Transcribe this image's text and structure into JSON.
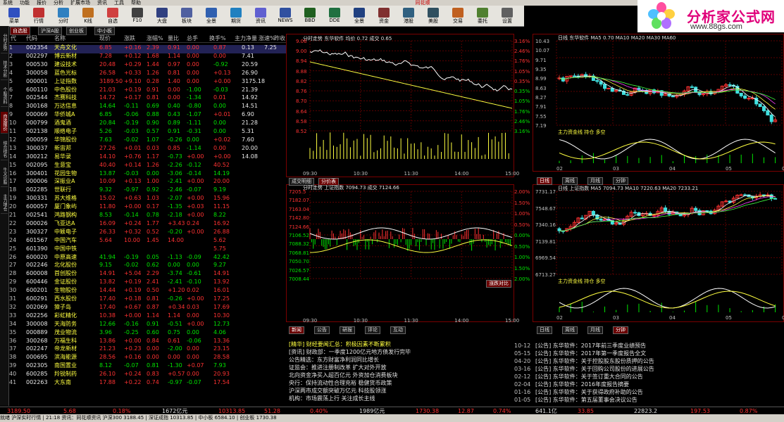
{
  "menu": [
    "系统",
    "功能",
    "报价",
    "分析",
    "扩展市场",
    "资讯",
    "工具",
    "帮助"
  ],
  "brand_center": "同花顺",
  "toolbar": [
    {
      "label": "菜单",
      "color": "#3050c0"
    },
    {
      "label": "行情",
      "color": "#c03030"
    },
    {
      "label": "分时",
      "color": "#3080c0"
    },
    {
      "label": "K线",
      "color": "#c07020"
    },
    {
      "label": "自选",
      "color": "#d04040"
    },
    {
      "label": "F10",
      "color": "#404040"
    },
    {
      "label": "大盘",
      "color": "#304080"
    },
    {
      "label": "板块",
      "color": "#5060a0"
    },
    {
      "label": "全景",
      "color": "#3060b0"
    },
    {
      "label": "期货",
      "color": "#2080c0"
    },
    {
      "label": "资讯",
      "color": "#6060d0"
    },
    {
      "label": "NEWS",
      "color": "#3050a0"
    },
    {
      "label": "BBD",
      "color": "#206020"
    },
    {
      "label": "DDE",
      "color": "#207040"
    },
    {
      "label": "全景",
      "color": "#204080"
    },
    {
      "label": "资金",
      "color": "#803030"
    },
    {
      "label": "港股",
      "color": "#306080"
    },
    {
      "label": "美股",
      "color": "#305060"
    },
    {
      "label": "交易",
      "color": "#c06020"
    },
    {
      "label": "委托",
      "color": "#508030"
    },
    {
      "label": "设置",
      "color": "#606060"
    }
  ],
  "ad": {
    "title": "分析家公式网",
    "url": "www.88gs.com"
  },
  "vertical_tabs": [
    "分时走势",
    "技术分析",
    "个股资料",
    "自选报价",
    "综合排名",
    "牛叉诊股",
    "主力增仓"
  ],
  "sheet_tabs": [
    "自选股",
    "沪深A股",
    "创业板",
    "中小板"
  ],
  "table": {
    "headers": [
      "代",
      "代码",
      "名称",
      "现价",
      "涨跌",
      "涨幅%",
      "量比",
      "总手",
      "换手%",
      "主力净量",
      "涨速%",
      "昨收"
    ],
    "rows": [
      [
        "1",
        "002354",
        "天舟文化",
        "6.85",
        "+0.16",
        "2.39",
        "0.91",
        "0.00",
        "0.87",
        "0.13",
        "7.25"
      ],
      [
        "2",
        "002297",
        "博云新材",
        "7.28",
        "+0.12",
        "1.68",
        "1.14",
        "0.00",
        "0.00",
        "7.41",
        ""
      ],
      [
        "3",
        "000530",
        "建设技术",
        "20.48",
        "+0.29",
        "1.44",
        "0.97",
        "0.00",
        "-0.92",
        "20.59",
        ""
      ],
      [
        "4",
        "300058",
        "蓝色光标",
        "26.58",
        "+0.33",
        "1.26",
        "0.81",
        "0.00",
        "+0.13",
        "26.90",
        ""
      ],
      [
        "5",
        "000001",
        "上证指数",
        "3189.50",
        "+9.10",
        "0.28",
        "1.40",
        "0.00",
        "+0.00",
        "3175.18",
        ""
      ],
      [
        "6",
        "600110",
        "中色股份",
        "21.03",
        "+0.19",
        "0.91",
        "0.00",
        "-1.00",
        "-0.03",
        "21.39",
        ""
      ],
      [
        "7",
        "002544",
        "杰赛科技",
        "14.72",
        "+0.17",
        "0.81",
        "0.00",
        "-1.34",
        "0.01",
        "14.92",
        ""
      ],
      [
        "8",
        "300168",
        "万达信息",
        "14.64",
        "-0.11",
        "0.69",
        "0.40",
        "-0.80",
        "0.00",
        "14.51",
        ""
      ],
      [
        "9",
        "000069",
        "华侨城A",
        "6.85",
        "-0.06",
        "0.88",
        "0.43",
        "-1.07",
        "+0.01",
        "6.90",
        ""
      ],
      [
        "10",
        "000799",
        "酒鬼酒",
        "20.84",
        "-0.19",
        "0.90",
        "0.89",
        "-1.11",
        "0.00",
        "21.28",
        ""
      ],
      [
        "11",
        "002138",
        "顺络电子",
        "5.26",
        "-0.03",
        "0.57",
        "0.91",
        "-0.31",
        "0.00",
        "5.31",
        ""
      ],
      [
        "12",
        "000059",
        "华锦股份",
        "7.63",
        "-0.02",
        "1.07",
        "-0.26",
        "0.00",
        "+0.02",
        "7.60",
        ""
      ],
      [
        "13",
        "300037",
        "新宙邦",
        "27.26",
        "+0.01",
        "0.03",
        "0.85",
        "-1.14",
        "0.00",
        "20.00",
        ""
      ],
      [
        "14",
        "300212",
        "易华录",
        "14.10",
        "+0.76",
        "1.17",
        "-0.73",
        "+0.00",
        "+0.00",
        "14.08",
        ""
      ],
      [
        "15",
        "002095",
        "生意宝",
        "40.40",
        "+0.14",
        "1.26",
        "-2.26",
        "-0.12",
        "40.52",
        ""
      ],
      [
        "16",
        "300401",
        "花园生物",
        "13.87",
        "-0.03",
        "0.00",
        "-3.06",
        "-0.14",
        "14.19",
        ""
      ],
      [
        "17",
        "000006",
        "深振业A",
        "10.09",
        "+0.13",
        "1.00",
        "-2.41",
        "+0.00",
        "20.00",
        ""
      ],
      [
        "18",
        "002285",
        "世联行",
        "9.32",
        "-0.97",
        "0.92",
        "-2.46",
        "-0.07",
        "9.19",
        ""
      ],
      [
        "19",
        "300331",
        "苏大维格",
        "15.02",
        "+0.63",
        "1.03",
        "-2.07",
        "+0.00",
        "15.96",
        ""
      ],
      [
        "20",
        "600057",
        "厦门象屿",
        "11.80",
        "+0.00",
        "0.17",
        "-1.35",
        "+0.03",
        "11.15",
        ""
      ],
      [
        "21",
        "002541",
        "鸿路钢构",
        "8.53",
        "-0.14",
        "0.78",
        "-2.18",
        "+0.00",
        "8.22",
        ""
      ],
      [
        "22",
        "000026",
        "飞亚达A",
        "16.09",
        "+0.24",
        "1.77",
        "+3.43",
        "0.24",
        "16.92",
        ""
      ],
      [
        "23",
        "300327",
        "中颖电子",
        "26.33",
        "+0.32",
        "0.52",
        "-0.20",
        "+0.00",
        "26.88",
        ""
      ],
      [
        "24",
        "601567",
        "中国汽车",
        "5.64",
        "10.00",
        "1.45",
        "14.00",
        "",
        "5.62",
        ""
      ],
      [
        "25",
        "601390",
        "中国中铁",
        "",
        "",
        "",
        "",
        "",
        "5.75",
        ""
      ],
      [
        "26",
        "600020",
        "中原高速",
        "41.94",
        "-0.19",
        "0.05",
        "-1.13",
        "-0.09",
        "42.42",
        ""
      ],
      [
        "27",
        "002246",
        "北化股份",
        "9.15",
        "-0.02",
        "0.62",
        "0.00",
        "0.00",
        "9.27",
        ""
      ],
      [
        "28",
        "600008",
        "首创股份",
        "14.91",
        "+5.04",
        "2.29",
        "-3.74",
        "-0.61",
        "14.91",
        ""
      ],
      [
        "29",
        "600446",
        "金证股份",
        "13.82",
        "+0.19",
        "2.41",
        "-2.41",
        "-0.10",
        "13.92",
        ""
      ],
      [
        "30",
        "600201",
        "生物股份",
        "14.44",
        "+0.19",
        "0.50",
        "+1.20",
        "0.02",
        "16.01",
        ""
      ],
      [
        "31",
        "600291",
        "西水股份",
        "17.40",
        "+0.18",
        "0.81",
        "-0.26",
        "+0.00",
        "17.25",
        ""
      ],
      [
        "32",
        "002069",
        "獐子岛",
        "17.40",
        "+0.67",
        "0.87",
        "+0.34",
        "0.03",
        "17.69",
        ""
      ],
      [
        "33",
        "002256",
        "彩虹精化",
        "10.38",
        "+0.00",
        "1.14",
        "1.14",
        "0.00",
        "10.30",
        ""
      ],
      [
        "34",
        "300008",
        "天海防务",
        "12.66",
        "-0.16",
        "0.91",
        "-0.51",
        "+0.00",
        "12.73",
        ""
      ],
      [
        "35",
        "000889",
        "茂业物流",
        "3.96",
        "-0.25",
        "0.60",
        "0.75",
        "0.00",
        "4.06",
        ""
      ],
      [
        "36",
        "300268",
        "万福生科",
        "13.86",
        "+0.00",
        "0.84",
        "0.61",
        "-0.06",
        "13.36",
        ""
      ],
      [
        "37",
        "002247",
        "帝龙新材",
        "21.23",
        "+0.23",
        "0.00",
        "-2.00",
        "0.00",
        "23.15",
        ""
      ],
      [
        "38",
        "000695",
        "滨海能源",
        "28.56",
        "+0.16",
        "0.00",
        "0.00",
        "0.00",
        "28.58",
        ""
      ],
      [
        "39",
        "002305",
        "南国置业",
        "8.12",
        "-0.07",
        "0.81",
        "-1.30",
        "+0.07",
        "7.93",
        ""
      ],
      [
        "40",
        "600285",
        "羚锐制药",
        "26.10",
        "+0.24",
        "0.83",
        "+0.57",
        "0.00",
        "20.93",
        ""
      ],
      [
        "41",
        "002263",
        "大东南",
        "17.88",
        "+0.22",
        "0.74",
        "-0.97",
        "-0.07",
        "17.54",
        ""
      ]
    ]
  },
  "intraday_top": {
    "title": "分时走势 东华软件 均价 0.72 成交 0.65",
    "price_labels": [
      "9.06",
      "9.00",
      "8.94",
      "8.88",
      "8.82",
      "8.76",
      "8.70",
      "8.64",
      "8.58",
      "8.52"
    ],
    "pct_labels": [
      "3.16%",
      "2.46%",
      "1.76%",
      "1.05%",
      "0.35%",
      "0.35%",
      "1.05%",
      "1.76%",
      "2.46%",
      "3.16%"
    ],
    "time_labels": [
      "09:30",
      "10:30",
      "11:30",
      "14:00",
      "15:00"
    ],
    "tabs": [
      "成交明细",
      "分价表"
    ]
  },
  "intraday_bottom": {
    "title": "分时走势 上证指数 7094.73 成交 7124.66",
    "price_labels": [
      "7205.5",
      "7182.07",
      "7163.04",
      "7142.80",
      "7124.66",
      "7106.52",
      "7088.32",
      "7068.81",
      "7050.70",
      "7026.57",
      "7008.44"
    ],
    "pct_labels": [
      "2.00%",
      "1.50%",
      "1.00%",
      "0.50%",
      "0.00%",
      "0.50%",
      "1.00%",
      "1.50%",
      "2.00%"
    ],
    "time_labels": [
      "09:30",
      "10:30",
      "11:30",
      "14:00",
      "15:00"
    ],
    "tag": "涨跌对比"
  },
  "kline_top": {
    "title": "日线 东华软件 MA5 0.70 MA10 MA20 MA30 MA60",
    "price_labels": [
      "10.43",
      "10.07",
      "9.71",
      "9.35",
      "8.99",
      "8.63",
      "8.27",
      "7.91",
      "7.55",
      "7.19"
    ],
    "vol_label": "主力资金线 持仓 多空",
    "date_labels": [
      "02",
      "03",
      "04",
      "05",
      "06"
    ],
    "tabs": [
      "日线",
      "周线",
      "月线",
      "分钟"
    ]
  },
  "kline_bottom": {
    "title": "日线 上证指数 MA5 7094.73 MA10 7220.63 MA20 7233.21",
    "price_labels": [
      "7731.17",
      "7548.67",
      "7340.16",
      "7139.81",
      "6969.54",
      "6713.27"
    ],
    "vol_label": "主力资金线 持仓 多空",
    "date_labels": [
      "02",
      "03",
      "04",
      "05",
      "06"
    ],
    "tabs": [
      "日线",
      "周线",
      "月线",
      "分钟"
    ]
  },
  "news_left": {
    "tabs": [
      "新闻",
      "公告",
      "研报",
      "评论",
      "互动"
    ],
    "items": [
      "[精华] 财经要闻汇总：积极因素不断累积",
      "[资讯] 财政部：一季度1200亿元地方债发行完毕",
      "公告精选：东方财富净利润同比增长",
      "证监会：推进注册制改革 扩大对外开放",
      "北向资金净买入超百亿元 外资加仓消费板块",
      "央行：保持流动性合理充裕 稳健货币政策",
      "沪深两市成交额突破万亿元 科技股领涨",
      "机构：市场震荡上行 关注成长主线"
    ]
  },
  "news_right": {
    "items": [
      {
        "date": "10-12",
        "text": "[公告] 东华软件：2017年前三季度业绩预告"
      },
      {
        "date": "05-15",
        "text": "[公告] 东华软件：2017年第一季度报告全文"
      },
      {
        "date": "04-20",
        "text": "[公告] 东华软件：关于控股股东股份质押的公告"
      },
      {
        "date": "03-16",
        "text": "[公告] 东华软件：关于回购公司股份的进展公告"
      },
      {
        "date": "02-12",
        "text": "[公告] 东华软件：关于签订重大合同的公告"
      },
      {
        "date": "02-04",
        "text": "[公告] 东华软件：2016年度报告摘要"
      },
      {
        "date": "01-16",
        "text": "[公告] 东华软件：关于获得政府补助的公告"
      },
      {
        "date": "01-05",
        "text": "[公告] 东华软件：第五届董事会决议公告"
      }
    ]
  },
  "status": {
    "sh_index": "3189.50",
    "sh_change": "5.68",
    "sh_pct": "0.18%",
    "sh_amount": "1672亿元",
    "sz_index": "10313.85",
    "sz_change": "51.28",
    "sz_pct": "0.40%",
    "sz_amount": "1989亿元",
    "cy_index": "1730.38",
    "cy_change": "12.87",
    "cy_pct": "0.74%",
    "cy_amount": "641.1亿",
    "right_a": "33.85",
    "right_b": "22823.2",
    "right_c": "197.53",
    "right_d": "0.87%"
  },
  "status2": "就绪 沪深实时行情 | 21:18 资讯：同花顺资讯 沪深300 3188.45 | 深证成指 10313.85 | 中小板 6584.10 | 创业板 1730.38"
}
